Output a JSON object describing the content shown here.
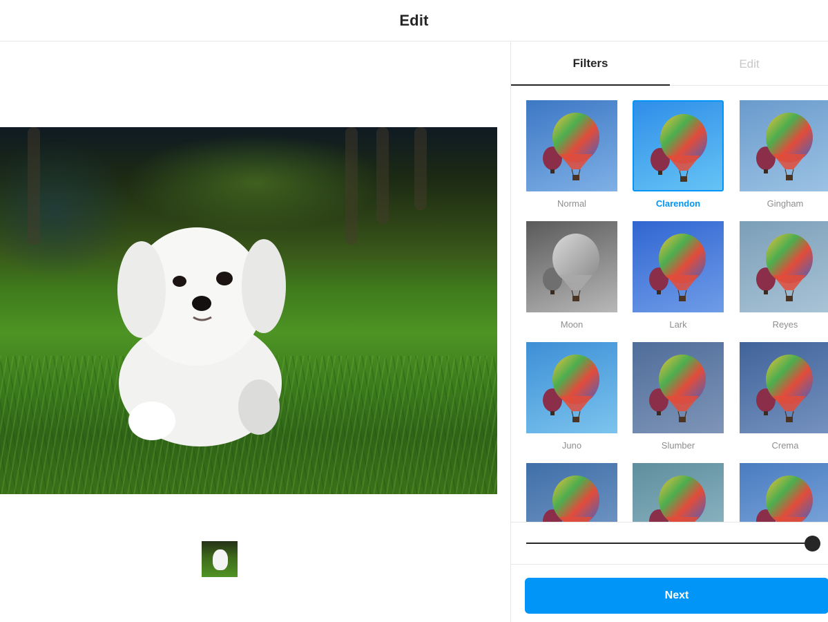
{
  "header": {
    "title": "Edit"
  },
  "tabs": [
    {
      "label": "Filters",
      "active": true
    },
    {
      "label": "Edit",
      "active": false
    }
  ],
  "filters": [
    {
      "name": "Normal",
      "selected": false,
      "bg": [
        "#3d78c4",
        "#7fb0e6"
      ],
      "tint": "none"
    },
    {
      "name": "Clarendon",
      "selected": true,
      "bg": [
        "#2f8ee8",
        "#66c3f5"
      ],
      "tint": "none"
    },
    {
      "name": "Gingham",
      "selected": false,
      "bg": [
        "#6a9bcc",
        "#9cc2e4"
      ],
      "tint": "none"
    },
    {
      "name": "Moon",
      "selected": false,
      "bg": [
        "#5a5a5a",
        "#b8b8b8"
      ],
      "tint": "grayscale"
    },
    {
      "name": "Lark",
      "selected": false,
      "bg": [
        "#3166d1",
        "#6f9ce8"
      ],
      "tint": "none"
    },
    {
      "name": "Reyes",
      "selected": false,
      "bg": [
        "#7b9fb8",
        "#a9c3d6"
      ],
      "tint": "none"
    },
    {
      "name": "Juno",
      "selected": false,
      "bg": [
        "#3d8fd6",
        "#7cc4ee"
      ],
      "tint": "none"
    },
    {
      "name": "Slumber",
      "selected": false,
      "bg": [
        "#4f6d9a",
        "#7f95b8"
      ],
      "tint": "none"
    },
    {
      "name": "Crema",
      "selected": false,
      "bg": [
        "#40639a",
        "#7592bf"
      ],
      "tint": "none"
    },
    {
      "name": "",
      "selected": false,
      "bg": [
        "#3f6fa8",
        "#7a9dc9"
      ],
      "tint": "none"
    },
    {
      "name": "",
      "selected": false,
      "bg": [
        "#5e8e9c",
        "#96bccb"
      ],
      "tint": "none"
    },
    {
      "name": "",
      "selected": false,
      "bg": [
        "#4a7cc0",
        "#86aee0"
      ],
      "tint": "none"
    }
  ],
  "slider": {
    "value": 100
  },
  "actions": {
    "next_label": "Next"
  },
  "colors": {
    "accent": "#0095f6",
    "text": "#262626",
    "muted": "#8e8e8e",
    "border": "#e6e6e6"
  }
}
